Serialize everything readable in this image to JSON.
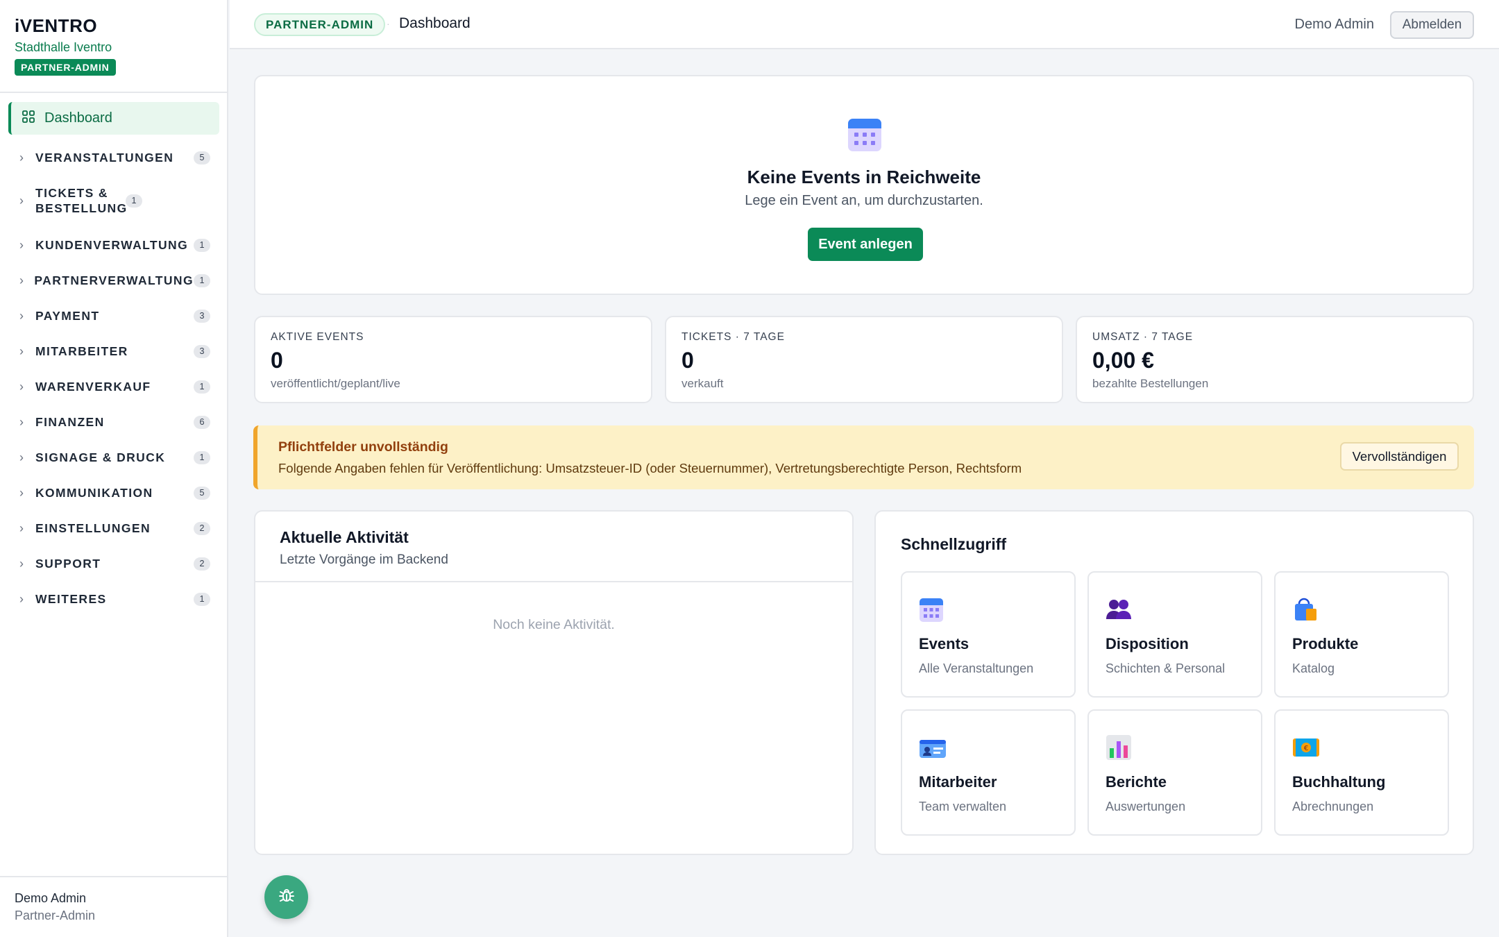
{
  "brand": {
    "name": "iVENTRO",
    "venue": "Stadthalle Iventro",
    "role_badge": "PARTNER-ADMIN"
  },
  "sidebar": {
    "active": {
      "label": "Dashboard",
      "icon": "grid-icon"
    },
    "items": [
      {
        "label": "VERANSTALTUNGEN",
        "count": "5"
      },
      {
        "label": "TICKETS & BESTELLUNG",
        "count": "1"
      },
      {
        "label": "KUNDENVERWALTUNG",
        "count": "1"
      },
      {
        "label": "PARTNERVERWALTUNG",
        "count": "1"
      },
      {
        "label": "PAYMENT",
        "count": "3"
      },
      {
        "label": "MITARBEITER",
        "count": "3"
      },
      {
        "label": "WARENVERKAUF",
        "count": "1"
      },
      {
        "label": "FINANZEN",
        "count": "6"
      },
      {
        "label": "SIGNAGE & DRUCK",
        "count": "1"
      },
      {
        "label": "KOMMUNIKATION",
        "count": "5"
      },
      {
        "label": "EINSTELLUNGEN",
        "count": "2"
      },
      {
        "label": "SUPPORT",
        "count": "2"
      },
      {
        "label": "WEITERES",
        "count": "1"
      }
    ],
    "footer": {
      "name": "Demo Admin",
      "role": "Partner-Admin"
    }
  },
  "topbar": {
    "badge": "PARTNER-ADMIN",
    "separator": "·",
    "title": "Dashboard",
    "user": "Demo Admin",
    "logout": "Abmelden"
  },
  "hero": {
    "icon": "calendar-icon",
    "title": "Keine Events in Reichweite",
    "subtitle": "Lege ein Event an, um durchzustarten.",
    "button": "Event anlegen"
  },
  "stats": [
    {
      "label": "AKTIVE EVENTS",
      "value": "0",
      "hint": "veröffentlicht/geplant/live"
    },
    {
      "label": "TICKETS · 7 TAGE",
      "value": "0",
      "hint": "verkauft"
    },
    {
      "label": "UMSATZ · 7 TAGE",
      "value": "0,00 €",
      "hint": "bezahlte Bestellungen"
    }
  ],
  "alert": {
    "title": "Pflichtfelder unvollständig",
    "text": "Folgende Angaben fehlen für Veröffentlichung: Umsatzsteuer-ID (oder Steuernummer), Vertretungsberechtigte Person, Rechtsform",
    "button": "Vervollständigen",
    "accent": "#f0a52c"
  },
  "activity": {
    "title": "Aktuelle Aktivität",
    "subtitle": "Letzte Vorgänge im Backend",
    "empty": "Noch keine Aktivität."
  },
  "quick": {
    "title": "Schnellzugriff",
    "tiles": [
      {
        "icon": "calendar-icon",
        "title": "Events",
        "sub": "Alle Veranstaltungen"
      },
      {
        "icon": "people-icon",
        "title": "Disposition",
        "sub": "Schichten & Personal"
      },
      {
        "icon": "shopping-bag-icon",
        "title": "Produkte",
        "sub": "Katalog"
      },
      {
        "icon": "id-card-icon",
        "title": "Mitarbeiter",
        "sub": "Team verwalten"
      },
      {
        "icon": "bar-chart-icon",
        "title": "Berichte",
        "sub": "Auswertungen"
      },
      {
        "icon": "money-icon",
        "title": "Buchhaltung",
        "sub": "Abrechnungen"
      }
    ]
  },
  "fab": {
    "icon": "bug-icon"
  },
  "colors": {
    "primary": "#0b8a57",
    "warning_bg": "#fdf1c7",
    "page_bg": "#f3f5f8"
  }
}
